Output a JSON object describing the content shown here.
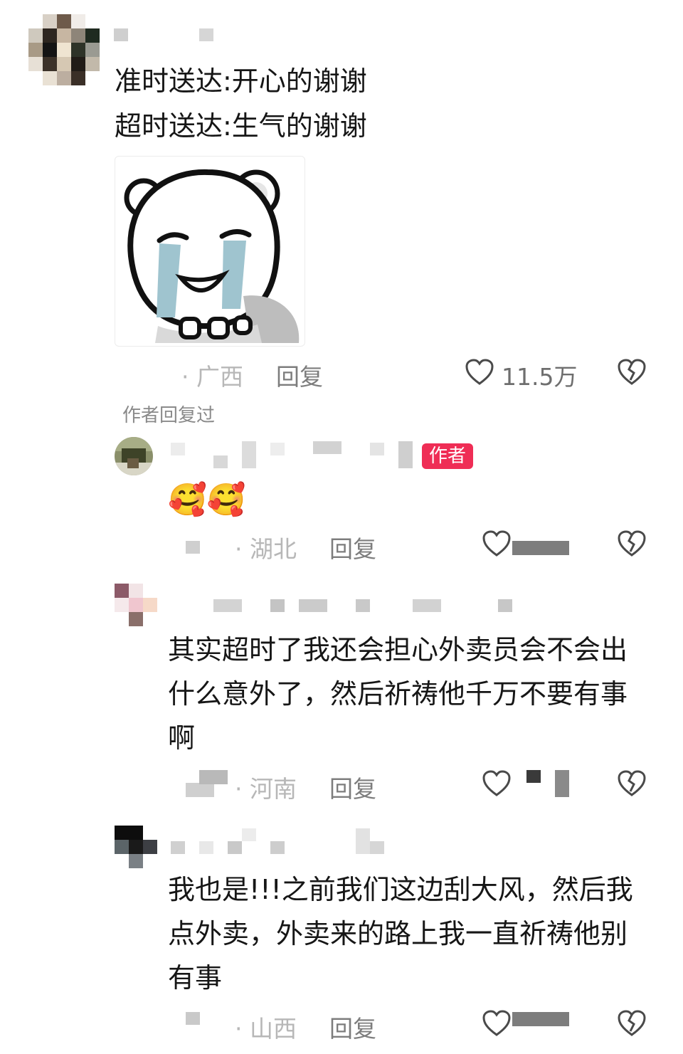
{
  "comments": [
    {
      "text_lines": [
        "准时送达:开心的谢谢",
        "超时送达:生气的谢谢"
      ],
      "location": "· 广西",
      "reply_label": "回复",
      "likes": "11.5万",
      "sticker": "crying-bear-sticker"
    },
    {
      "author_badge": "作者",
      "emoji": "🥰🥰",
      "location": "· 湖北",
      "reply_label": "回复"
    },
    {
      "text": "其实超时了我还会担心外卖员会不会出什么意外了，然后祈祷他千万不要有事啊",
      "text_lines": [
        "其实超时了我还会担心外卖员会不会出",
        "什么意外了，然后祈祷他千万不要有事",
        "啊"
      ],
      "location": "· 河南",
      "reply_label": "回复"
    },
    {
      "text": "我也是!!!之前我们这边刮大风，然后我点外卖，外卖来的路上我一直祈祷他别有事",
      "text_lines": [
        "我也是!!!之前我们这边刮大风，然后我",
        "点外卖，外卖来的路上我一直祈祷他别",
        "有事"
      ],
      "location": "· 山西",
      "reply_label": "回复"
    }
  ],
  "author_replied_label": "作者回复过",
  "icons": {
    "like": "heart-outline-icon",
    "dislike": "broken-heart-icon"
  }
}
